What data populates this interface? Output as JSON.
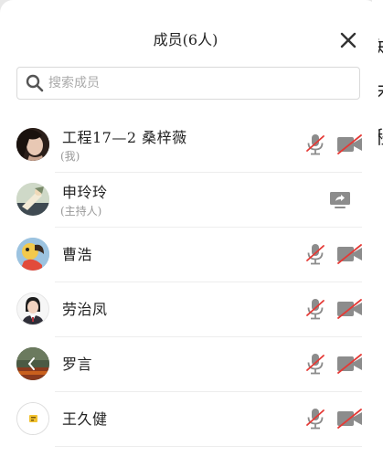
{
  "panel": {
    "title": "成员(6人)",
    "search_placeholder": "搜索成员"
  },
  "members": [
    {
      "name": "工程17—2 桑梓薇",
      "tag": "(我)",
      "mic": "muted",
      "camera": "off"
    },
    {
      "name": "申玲玲",
      "tag": "(主持人)",
      "status": "screen-sharing"
    },
    {
      "name": "曹浩",
      "mic": "muted",
      "camera": "off"
    },
    {
      "name": "劳治凤",
      "mic": "muted",
      "camera": "off"
    },
    {
      "name": "罗言",
      "mic": "muted",
      "camera": "off"
    },
    {
      "name": "王久健",
      "mic": "muted",
      "camera": "off"
    }
  ],
  "background_right_edge_text": [
    "知",
    "未",
    "程"
  ],
  "colors": {
    "muted_slash": "#e53935",
    "icon_gray": "#8c8c8c"
  }
}
